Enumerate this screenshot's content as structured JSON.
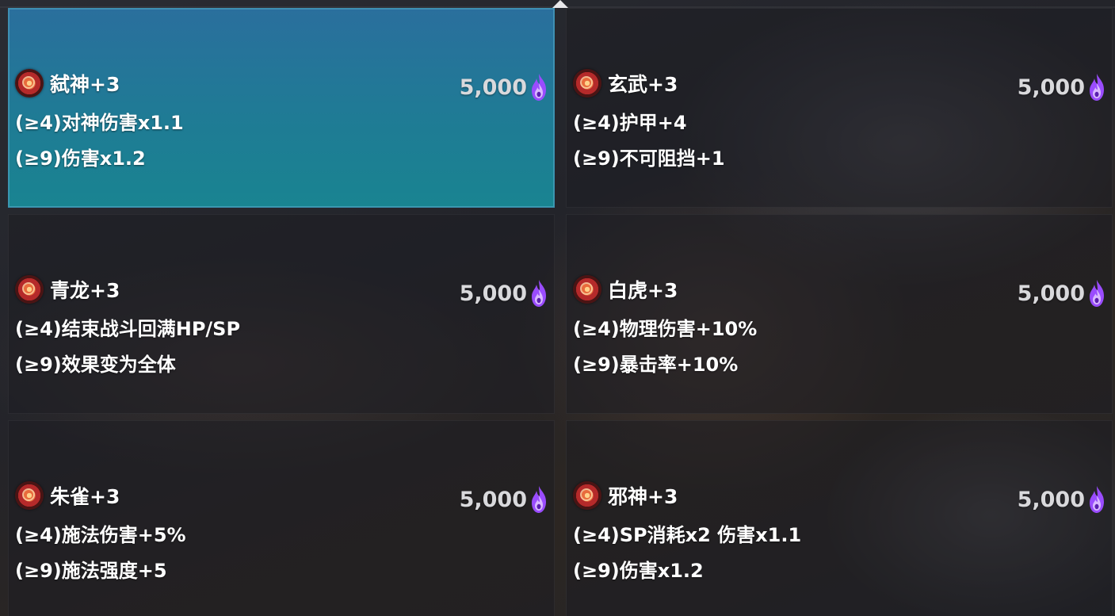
{
  "currency_icon": "purple-flame-icon",
  "cards": [
    {
      "name": "弑神+3",
      "price": "5,000",
      "effects": [
        "(≥4)对神伤害x1.1",
        "(≥9)伤害x1.2"
      ],
      "selected": true
    },
    {
      "name": "玄武+3",
      "price": "5,000",
      "effects": [
        "(≥4)护甲+4",
        "(≥9)不可阻挡+1"
      ],
      "selected": false
    },
    {
      "name": "青龙+3",
      "price": "5,000",
      "effects": [
        "(≥4)结束战斗回满HP/SP",
        "(≥9)效果变为全体"
      ],
      "selected": false
    },
    {
      "name": "白虎+3",
      "price": "5,000",
      "effects": [
        "(≥4)物理伤害+10%",
        "(≥9)暴击率+10%"
      ],
      "selected": false
    },
    {
      "name": "朱雀+3",
      "price": "5,000",
      "effects": [
        "(≥4)施法伤害+5%",
        "(≥9)施法强度+5"
      ],
      "selected": false
    },
    {
      "name": "邪神+3",
      "price": "5,000",
      "effects": [
        "(≥4)SP消耗x2 伤害x1.1",
        "(≥9)伤害x1.2"
      ],
      "selected": false
    }
  ],
  "colors": {
    "selected_card": "#1f7b95",
    "price_flame": "#9a4cff"
  }
}
